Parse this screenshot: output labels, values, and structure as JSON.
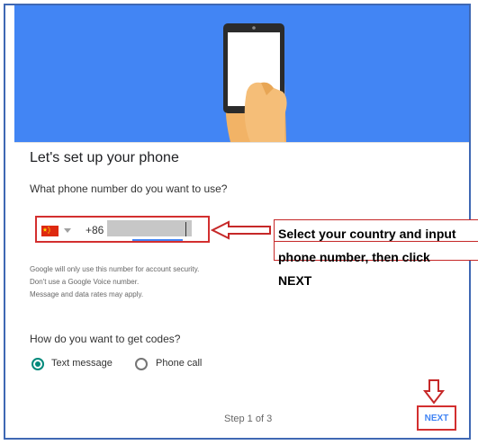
{
  "dialog": {
    "title": "Let's set up your phone",
    "question": "What phone number do you want to use?"
  },
  "phone": {
    "country_flag": "china-flag-icon",
    "country_code": "+86",
    "number_value": "",
    "number_state": "redacted"
  },
  "callout": {
    "lines": [
      "Select your country and input",
      "phone number, then click",
      "NEXT"
    ]
  },
  "disclaimer": {
    "lines": [
      "Google will only use this number for account security.",
      "Don't use a Google Voice number.",
      "Message and data rates may apply."
    ]
  },
  "codes": {
    "question": "How do you want to get codes?",
    "options": [
      {
        "label": "Text message",
        "selected": true
      },
      {
        "label": "Phone call",
        "selected": false
      }
    ]
  },
  "footer": {
    "step": "Step 1 of 3",
    "next_label": "NEXT"
  },
  "colors": {
    "hero_blue": "#4285f4",
    "annotation_red": "#d32f2f",
    "radio_teal": "#00897b"
  }
}
